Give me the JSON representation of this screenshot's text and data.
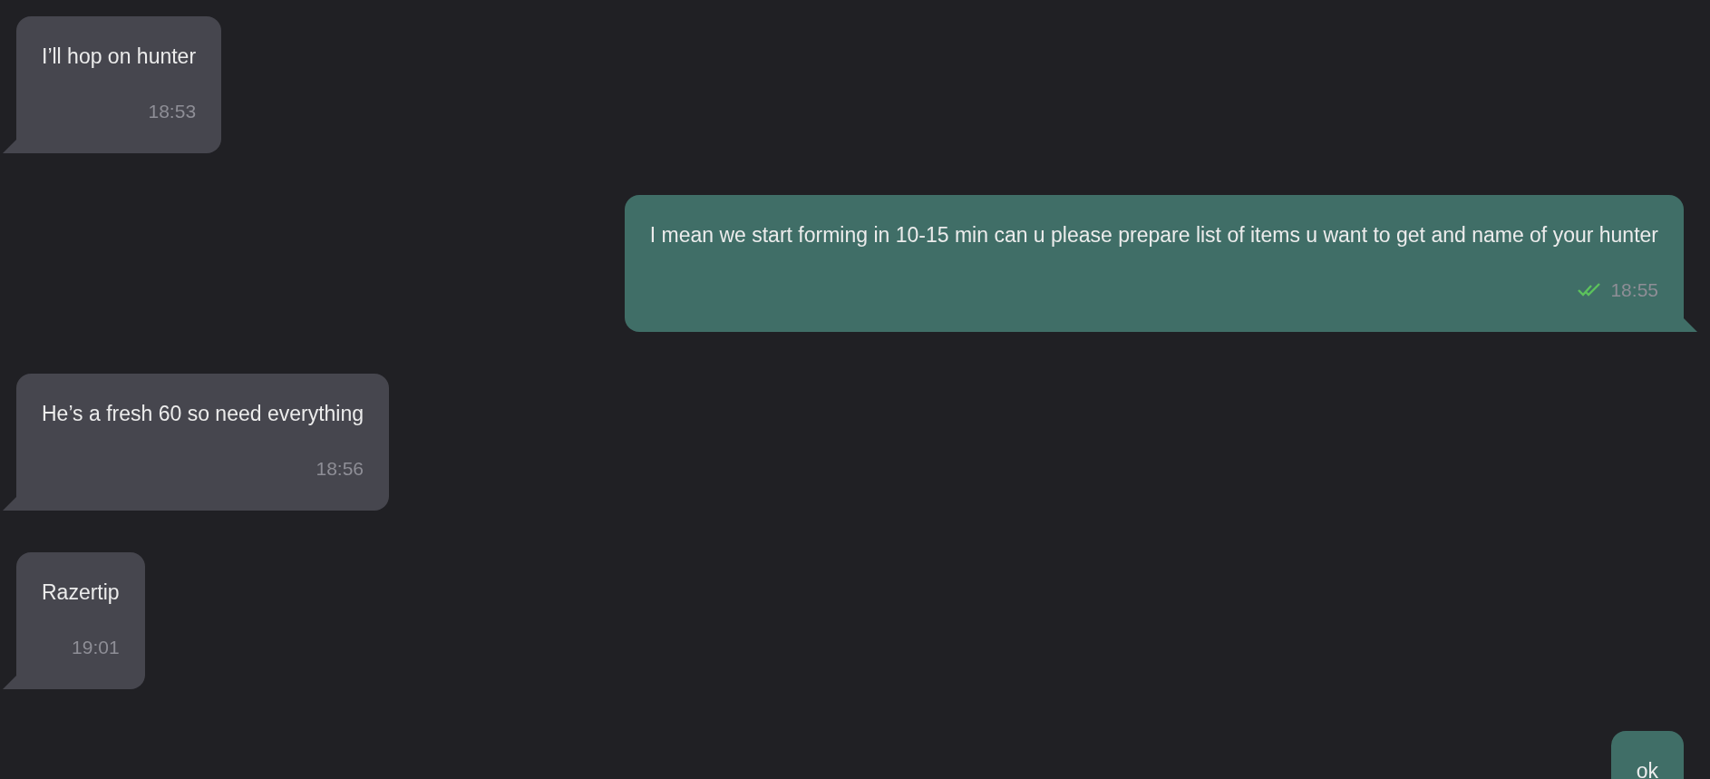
{
  "messages": [
    {
      "kind": "incoming",
      "text": "I’ll hop on hunter",
      "time": "18:53"
    },
    {
      "kind": "outgoing",
      "text": "I mean we start forming in 10-15 min can u please prepare list of items u want to get and name of your hunter",
      "time": "18:55",
      "read": true
    },
    {
      "kind": "incoming",
      "text": "He’s a fresh 60 so need everything",
      "time": "18:56"
    },
    {
      "kind": "incoming",
      "text": "Razertip",
      "time": "19:01"
    },
    {
      "kind": "outgoing",
      "text": "ok"
    }
  ]
}
